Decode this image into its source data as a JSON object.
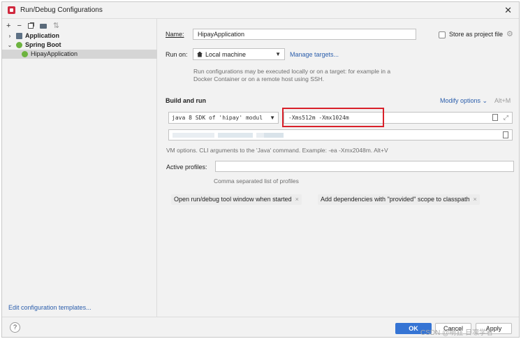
{
  "window": {
    "title": "Run/Debug Configurations"
  },
  "left_panel": {
    "tree": [
      {
        "label": "Application",
        "expanded": false,
        "icon": "application-icon"
      },
      {
        "label": "Spring Boot",
        "expanded": true,
        "icon": "spring-boot-icon"
      },
      {
        "label": "HipayApplication",
        "selected": true,
        "icon": "spring-boot-icon"
      }
    ],
    "edit_templates": "Edit configuration templates..."
  },
  "form": {
    "name_label": "Name:",
    "name_value": "HipayApplication",
    "store_label": "Store as project file",
    "store_checked": false,
    "run_on_label": "Run on:",
    "run_on_value": "Local machine",
    "manage_targets": "Manage targets...",
    "run_hint": "Run configurations may be executed locally or on a target: for example in a Docker Container or on a remote host using SSH.",
    "build_and_run": "Build and run",
    "modify_options": "Modify options",
    "modify_shortcut": "Alt+M",
    "jdk_value": "java 8 SDK of 'hipay' modul",
    "vm_options_value": "-Xms512m -Xmx1024m",
    "vm_hint": "VM options. CLI arguments to the 'Java' command. Example: -ea -Xmx2048m. Alt+V",
    "profiles_label": "Active profiles:",
    "profiles_value": "",
    "profiles_hint": "Comma separated list of profiles",
    "chips": [
      "Open run/debug tool window when started",
      "Add dependencies with \"provided\" scope to classpath"
    ]
  },
  "footer": {
    "help": "?",
    "ok": "OK",
    "cancel": "Cancel",
    "apply": "Apply",
    "watermark": "CSDN @萌狂 日凛学者"
  },
  "colors": {
    "accent": "#3574d4",
    "link": "#2a5dab",
    "highlight_box": "#d9202a"
  }
}
